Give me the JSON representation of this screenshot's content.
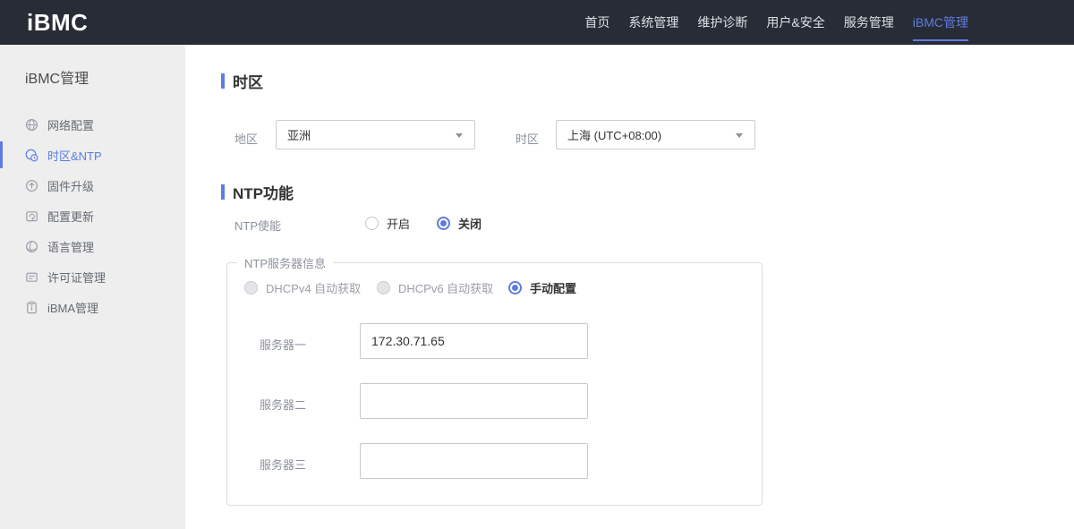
{
  "header": {
    "logo": "iBMC",
    "nav": [
      {
        "label": "首页",
        "active": false
      },
      {
        "label": "系统管理",
        "active": false
      },
      {
        "label": "维护诊断",
        "active": false
      },
      {
        "label": "用户&安全",
        "active": false
      },
      {
        "label": "服务管理",
        "active": false
      },
      {
        "label": "iBMC管理",
        "active": true
      }
    ]
  },
  "sidebar": {
    "title": "iBMC管理",
    "items": [
      {
        "label": "网络配置",
        "icon": "network-icon",
        "active": false
      },
      {
        "label": "时区&NTP",
        "icon": "timezone-icon",
        "active": true
      },
      {
        "label": "固件升级",
        "icon": "firmware-upgrade-icon",
        "active": false
      },
      {
        "label": "配置更新",
        "icon": "config-update-icon",
        "active": false
      },
      {
        "label": "语言管理",
        "icon": "language-icon",
        "active": false
      },
      {
        "label": "许可证管理",
        "icon": "license-icon",
        "active": false
      },
      {
        "label": "iBMA管理",
        "icon": "ibma-icon",
        "active": false
      }
    ]
  },
  "main": {
    "timezone_section": {
      "title": "时区",
      "region_label": "地区",
      "region_value": "亚洲",
      "timezone_label": "时区",
      "timezone_value": "上海 (UTC+08:00)"
    },
    "ntp_section": {
      "title": "NTP功能",
      "enable_label": "NTP使能",
      "enable_options": [
        {
          "label": "开启",
          "selected": false
        },
        {
          "label": "关闭",
          "selected": true
        }
      ],
      "server_group": {
        "legend": "NTP服务器信息",
        "mode_options": [
          {
            "label": "DHCPv4 自动获取",
            "selected": false,
            "disabled": true
          },
          {
            "label": "DHCPv6 自动获取",
            "selected": false,
            "disabled": true
          },
          {
            "label": "手动配置",
            "selected": true,
            "disabled": false
          }
        ],
        "servers": [
          {
            "label": "服务器一",
            "value": "172.30.71.65"
          },
          {
            "label": "服务器二",
            "value": ""
          },
          {
            "label": "服务器三",
            "value": ""
          }
        ]
      }
    }
  },
  "colors": {
    "accent": "#5e7ce0",
    "topbar_bg": "#282c36",
    "sidebar_bg": "#eeeeee"
  }
}
